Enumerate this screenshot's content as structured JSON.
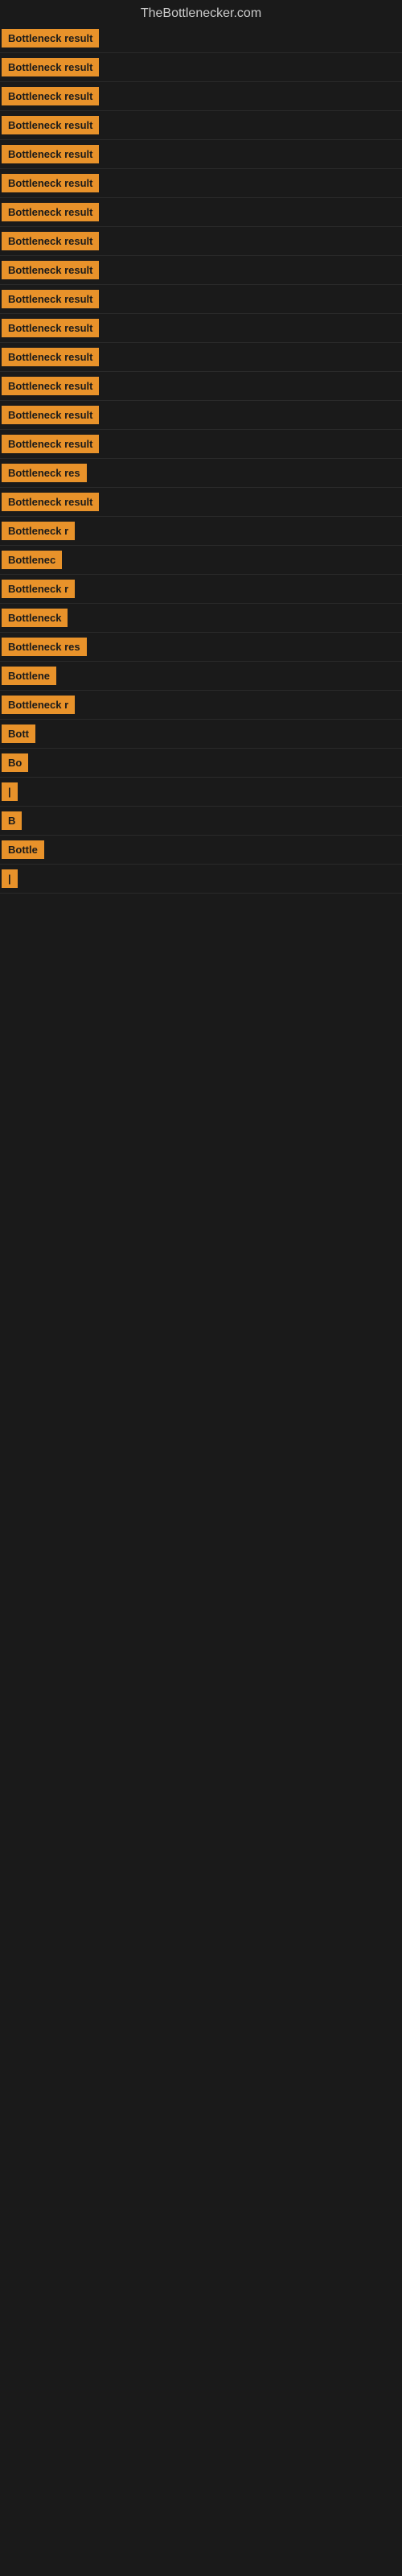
{
  "site": {
    "title": "TheBottlenecker.com"
  },
  "items": [
    {
      "label": "Bottleneck result",
      "bar_width": 0
    },
    {
      "label": "Bottleneck result",
      "bar_width": 0
    },
    {
      "label": "Bottleneck result",
      "bar_width": 0
    },
    {
      "label": "Bottleneck result",
      "bar_width": 0
    },
    {
      "label": "Bottleneck result",
      "bar_width": 0
    },
    {
      "label": "Bottleneck result",
      "bar_width": 0
    },
    {
      "label": "Bottleneck result",
      "bar_width": 0
    },
    {
      "label": "Bottleneck result",
      "bar_width": 0
    },
    {
      "label": "Bottleneck result",
      "bar_width": 0
    },
    {
      "label": "Bottleneck result",
      "bar_width": 0
    },
    {
      "label": "Bottleneck result",
      "bar_width": 0
    },
    {
      "label": "Bottleneck result",
      "bar_width": 0
    },
    {
      "label": "Bottleneck result",
      "bar_width": 0
    },
    {
      "label": "Bottleneck result",
      "bar_width": 0
    },
    {
      "label": "Bottleneck result",
      "bar_width": 0
    },
    {
      "label": "Bottleneck res",
      "bar_width": 0
    },
    {
      "label": "Bottleneck result",
      "bar_width": 0
    },
    {
      "label": "Bottleneck r",
      "bar_width": 0
    },
    {
      "label": "Bottlenec",
      "bar_width": 0
    },
    {
      "label": "Bottleneck r",
      "bar_width": 0
    },
    {
      "label": "Bottleneck",
      "bar_width": 0
    },
    {
      "label": "Bottleneck res",
      "bar_width": 0
    },
    {
      "label": "Bottlene",
      "bar_width": 0
    },
    {
      "label": "Bottleneck r",
      "bar_width": 0
    },
    {
      "label": "Bott",
      "bar_width": 0
    },
    {
      "label": "Bo",
      "bar_width": 0
    },
    {
      "label": "|",
      "bar_width": 0
    },
    {
      "label": "B",
      "bar_width": 0
    },
    {
      "label": "Bottle",
      "bar_width": 0
    },
    {
      "label": "|",
      "bar_width": 0
    }
  ]
}
